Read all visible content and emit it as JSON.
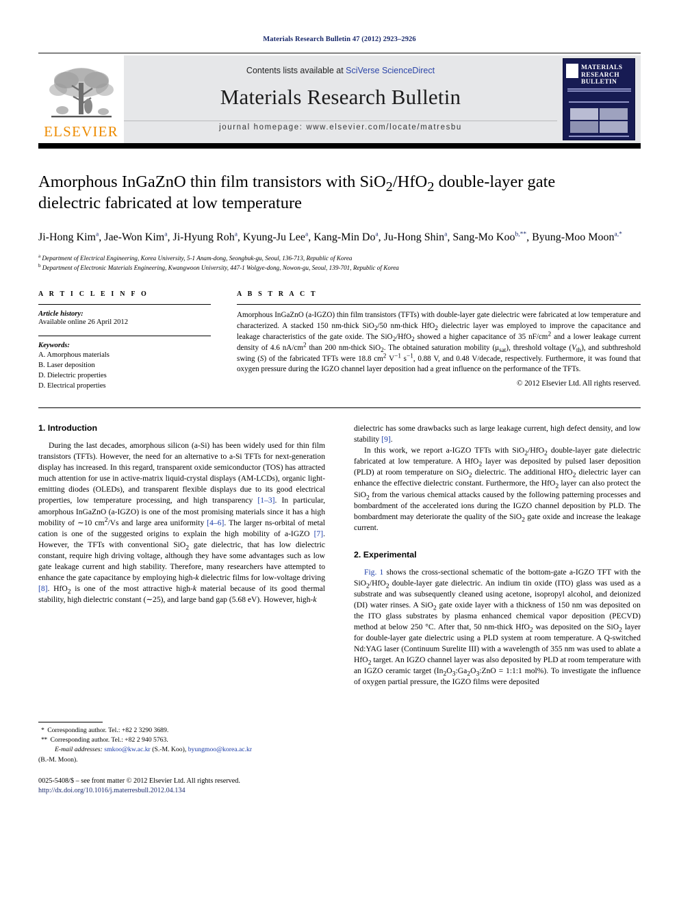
{
  "running_head": "Materials Research Bulletin 47 (2012) 2923–2926",
  "masthead": {
    "contents_prefix": "Contents lists available at ",
    "contents_link": "SciVerse ScienceDirect",
    "journal_title": "Materials Research Bulletin",
    "homepage": "journal homepage: www.elsevier.com/locate/matresbu",
    "publisher_wordmark": "ELSEVIER",
    "cover_title": "MATERIALS RESEARCH BULLETIN"
  },
  "article": {
    "title": "Amorphous InGaZnO thin film transistors with SiO2/HfO2 double-layer gate dielectric fabricated at low temperature",
    "authors": "Ji-Hong Kim a, Jae-Won Kim a, Ji-Hyung Roh a, Kyung-Ju Lee a, Kang-Min Do a, Ju-Hong Shin a, Sang-Mo Koo b,**, Byung-Moo Moon a,*",
    "affiliation_a": "Department of Electrical Engineering, Korea University, 5-1 Anam-dong, Seongbuk-gu, Seoul, 136-713, Republic of Korea",
    "affiliation_b": "Department of Electronic Materials Engineering, Kwangwoon University, 447-1 Wolgye-dong, Nowon-gu, Seoul, 139-701, Republic of Korea"
  },
  "article_info": {
    "heading": "A R T I C L E   I N F O",
    "history_label": "Article history:",
    "history_value": "Available online 26 April 2012",
    "keywords_label": "Keywords:",
    "keywords": [
      "A. Amorphous materials",
      "B. Laser deposition",
      "D. Dielectric properties",
      "D. Electrical properties"
    ]
  },
  "abstract": {
    "heading": "A B S T R A C T",
    "copyright": "© 2012 Elsevier Ltd. All rights reserved."
  },
  "sections": {
    "intro_heading": "1. Introduction",
    "experimental_heading": "2. Experimental"
  },
  "footnotes": {
    "corr1": "Corresponding author. Tel.: +82 2 3290 3689.",
    "corr2": "Corresponding author. Tel.: +82 2 940 5763.",
    "email_label": "E-mail addresses:",
    "email1": "smkoo@kw.ac.kr",
    "email1_owner": "(S.-M. Koo),",
    "email2": "byungmoo@korea.ac.kr",
    "email2_owner": "(B.-M. Moon).",
    "issn_line": "0025-5408/$ – see front matter © 2012 Elsevier Ltd. All rights reserved.",
    "doi": "http://dx.doi.org/10.1016/j.materresbull.2012.04.134"
  }
}
